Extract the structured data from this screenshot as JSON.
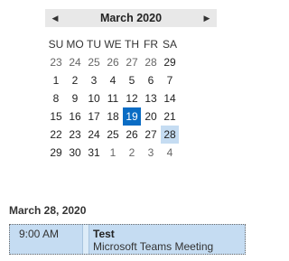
{
  "calendar": {
    "prev_glyph": "◀",
    "next_glyph": "▶",
    "month_title": "March 2020",
    "weekdays": [
      "SU",
      "MO",
      "TU",
      "WE",
      "TH",
      "FR",
      "SA"
    ],
    "weeks": [
      [
        {
          "d": "23",
          "other": true
        },
        {
          "d": "24",
          "other": true
        },
        {
          "d": "25",
          "other": true
        },
        {
          "d": "26",
          "other": true
        },
        {
          "d": "27",
          "other": true
        },
        {
          "d": "28",
          "other": true
        },
        {
          "d": "29",
          "other": false
        }
      ],
      [
        {
          "d": "1",
          "other": false
        },
        {
          "d": "2",
          "other": false
        },
        {
          "d": "3",
          "other": false
        },
        {
          "d": "4",
          "other": false
        },
        {
          "d": "5",
          "other": false
        },
        {
          "d": "6",
          "other": false
        },
        {
          "d": "7",
          "other": false
        }
      ],
      [
        {
          "d": "8",
          "other": false
        },
        {
          "d": "9",
          "other": false
        },
        {
          "d": "10",
          "other": false
        },
        {
          "d": "11",
          "other": false
        },
        {
          "d": "12",
          "other": false
        },
        {
          "d": "13",
          "other": false
        },
        {
          "d": "14",
          "other": false
        }
      ],
      [
        {
          "d": "15",
          "other": false
        },
        {
          "d": "16",
          "other": false
        },
        {
          "d": "17",
          "other": false
        },
        {
          "d": "18",
          "other": false
        },
        {
          "d": "19",
          "other": false,
          "today": true
        },
        {
          "d": "20",
          "other": false
        },
        {
          "d": "21",
          "other": false
        }
      ],
      [
        {
          "d": "22",
          "other": false
        },
        {
          "d": "23",
          "other": false
        },
        {
          "d": "24",
          "other": false
        },
        {
          "d": "25",
          "other": false
        },
        {
          "d": "26",
          "other": false
        },
        {
          "d": "27",
          "other": false
        },
        {
          "d": "28",
          "other": false,
          "selected": true
        }
      ],
      [
        {
          "d": "29",
          "other": false
        },
        {
          "d": "30",
          "other": false
        },
        {
          "d": "31",
          "other": false
        },
        {
          "d": "1",
          "other": true
        },
        {
          "d": "2",
          "other": true
        },
        {
          "d": "3",
          "other": true
        },
        {
          "d": "4",
          "other": true
        }
      ]
    ],
    "colors": {
      "today_bg": "#0a6cc4",
      "selected_bg": "#c5dcf2",
      "header_bg": "#e8e8e8"
    }
  },
  "agenda": {
    "date_heading": "March 28, 2020",
    "appointments": [
      {
        "time": "9:00 AM",
        "title": "Test",
        "location": "Microsoft Teams Meeting"
      }
    ]
  }
}
